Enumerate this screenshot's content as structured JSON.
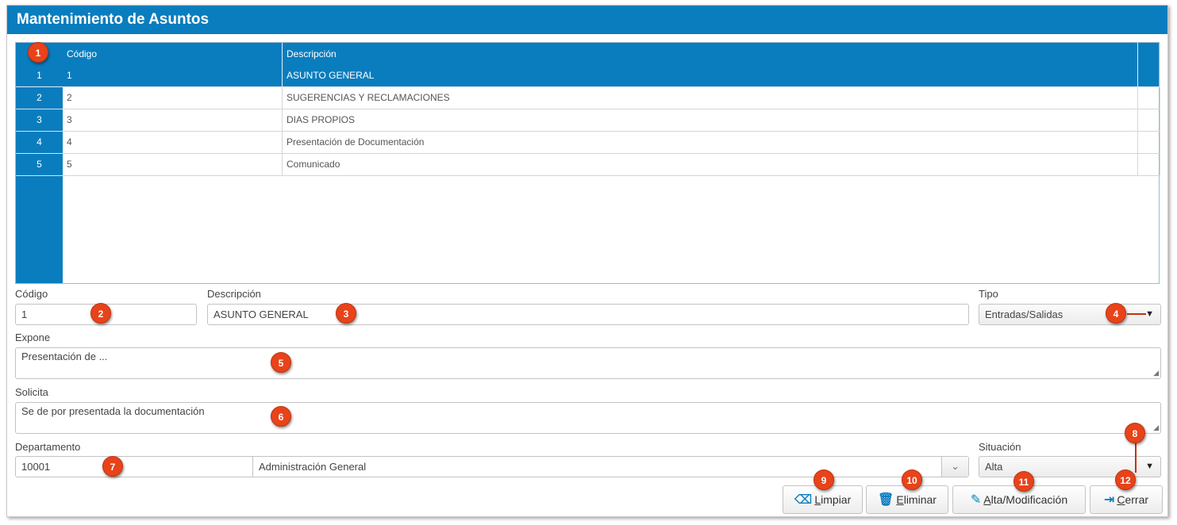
{
  "window": {
    "title": "Mantenimiento de Asuntos"
  },
  "grid": {
    "columns": [
      "Código",
      "Descripción"
    ],
    "rows": [
      {
        "num": "1",
        "code": "1",
        "desc": "ASUNTO GENERAL",
        "selected": true
      },
      {
        "num": "2",
        "code": "2",
        "desc": "SUGERENCIAS Y RECLAMACIONES"
      },
      {
        "num": "3",
        "code": "3",
        "desc": "DIAS PROPIOS"
      },
      {
        "num": "4",
        "code": "4",
        "desc": "Presentación de Documentación"
      },
      {
        "num": "5",
        "code": "5",
        "desc": "Comunicado"
      }
    ]
  },
  "form": {
    "codigo": {
      "label": "Código",
      "value": "1"
    },
    "descripcion": {
      "label": "Descripción",
      "value": "ASUNTO GENERAL"
    },
    "tipo": {
      "label": "Tipo",
      "value": "Entradas/Salidas"
    },
    "expone": {
      "label": "Expone",
      "value": "Presentación de ..."
    },
    "solicita": {
      "label": "Solicita",
      "value": "Se de por presentada la documentación"
    },
    "departamento": {
      "label": "Departamento",
      "code": "10001",
      "name": "Administración General"
    },
    "situacion": {
      "label": "Situación",
      "value": "Alta"
    }
  },
  "buttons": {
    "limpiar": {
      "first": "L",
      "rest": "impiar"
    },
    "eliminar": {
      "first": "E",
      "rest": "liminar"
    },
    "alta": {
      "first": "A",
      "rest": "lta/Modificación"
    },
    "cerrar": {
      "first": "C",
      "rest": "errar"
    }
  },
  "callouts": [
    "1",
    "2",
    "3",
    "4",
    "5",
    "6",
    "7",
    "8",
    "9",
    "10",
    "11",
    "12"
  ],
  "colors": {
    "accent": "#0a7dbe",
    "callout": "#e8431a"
  }
}
